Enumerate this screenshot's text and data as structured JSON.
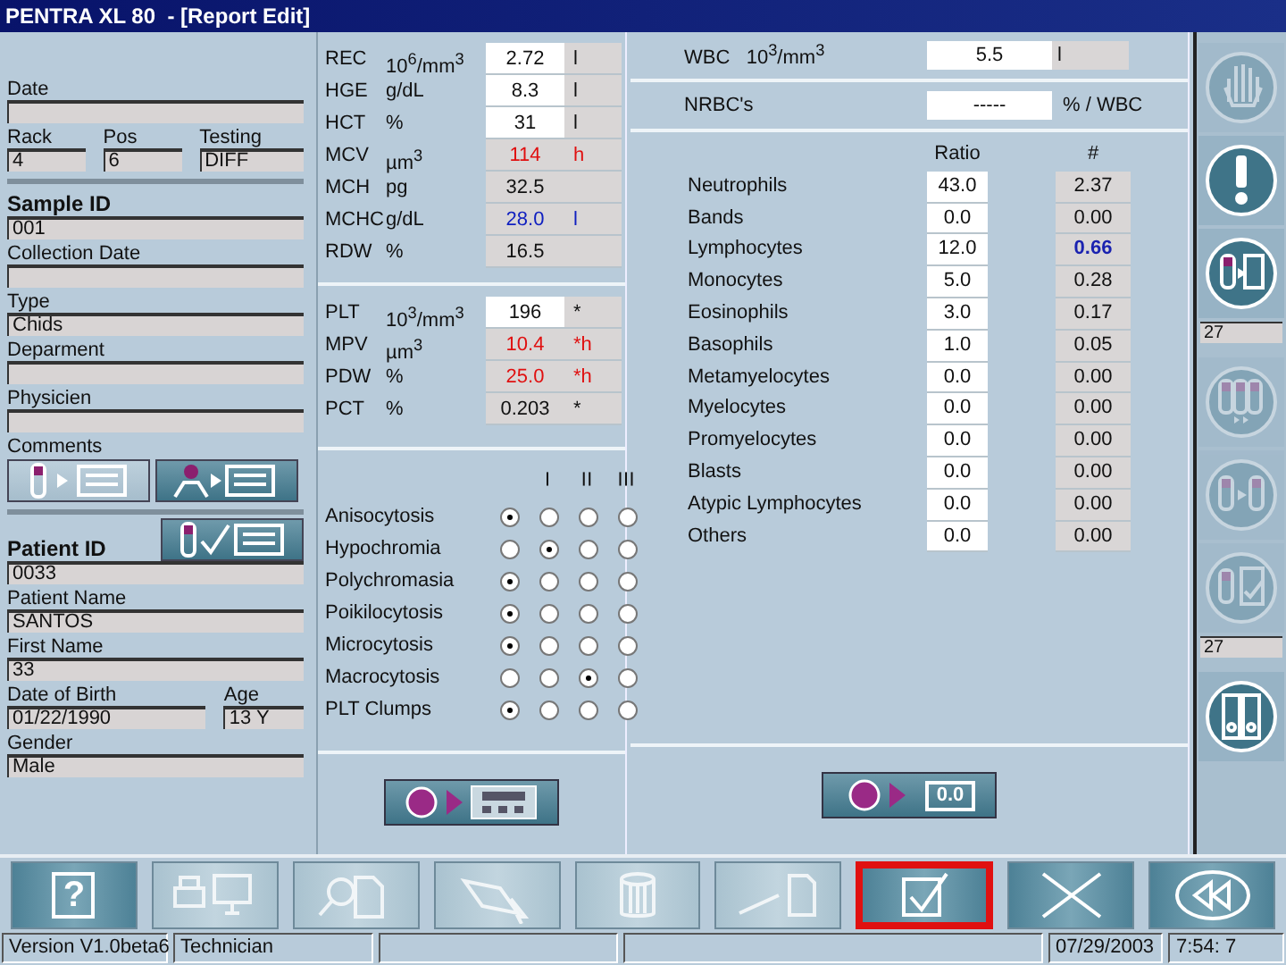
{
  "window": {
    "title": "PENTRA XL 80  - [Report Edit]"
  },
  "sample_info": [
    {
      "kind": "field",
      "label": "Date"
    },
    {
      "kind": "group",
      "fields": [
        {
          "label": "Rack",
          "value": "4"
        },
        {
          "label": "Pos",
          "value": "6"
        },
        {
          "label": "Testing",
          "value": "DIFF"
        }
      ]
    },
    {
      "kind": "heading",
      "label": "Sample ID",
      "value": "001"
    },
    {
      "kind": "field",
      "label": "Collection Date"
    },
    {
      "kind": "field",
      "label": "Type",
      "value": "Chids"
    },
    {
      "kind": "field",
      "label": "Deparment"
    },
    {
      "kind": "field",
      "label": "Physicien"
    },
    {
      "kind": "buttons",
      "label": "Comments",
      "buttons": [
        {
          "disabled": true
        },
        {
          "disabled": false
        }
      ]
    },
    {
      "kind": "heading",
      "label": "Patient ID",
      "value": "0033",
      "button": {
        "disabled": false
      }
    },
    {
      "kind": "field",
      "label": "Patient Name",
      "value": "SANTOS"
    },
    {
      "kind": "field",
      "label": "First Name",
      "value": "33"
    },
    {
      "kind": "group",
      "fields": [
        {
          "label": "Date of Birth",
          "value": "01/22/1990"
        },
        {
          "label": "Age",
          "value": "13 Y"
        }
      ]
    },
    {
      "kind": "field",
      "label": "Gender",
      "value": "Male"
    }
  ],
  "red_cells": [
    {
      "name": "REC",
      "unit": "10$^{6}$/mm$^{3}$",
      "value": "2.72",
      "flag": "l",
      "editable": true
    },
    {
      "name": "HGE",
      "unit": "g/dL",
      "value": "8.3",
      "flag": "l",
      "editable": true
    },
    {
      "name": "HCT",
      "unit": "%",
      "value": "31",
      "flag": "l",
      "editable": true
    },
    {
      "name": "MCV",
      "unit": "µm$^{3}$",
      "value": "114",
      "flag": "h",
      "editable": false,
      "color": "#e01010"
    },
    {
      "name": "MCH",
      "unit": "pg",
      "value": "32.5",
      "editable": false
    },
    {
      "name": "MCHC",
      "unit": "g/dL",
      "value": "28.0",
      "flag": "l",
      "editable": false,
      "color": "#1020c0"
    },
    {
      "name": "RDW",
      "unit": "%",
      "value": "16.5",
      "editable": false
    }
  ],
  "platelets": [
    {
      "name": "PLT",
      "unit": "10$^{3}$/mm$^{3}$",
      "value": "196",
      "flag": "*",
      "editable": true
    },
    {
      "name": "MPV",
      "unit": "µm$^{3}$",
      "value": "10.4",
      "flag": "*h",
      "editable": false,
      "color": "#e01010"
    },
    {
      "name": "PDW",
      "unit": "%",
      "value": "25.0",
      "flag": "*h",
      "editable": false,
      "color": "#e01010"
    },
    {
      "name": "PCT",
      "unit": "%",
      "value": "0.203",
      "flag": "*",
      "editable": false
    }
  ],
  "morphology": {
    "grade_headers": [
      "|",
      "||",
      "|||"
    ],
    "rows": [
      {
        "name": "Anisocytosis",
        "options": [
          {
            "selected": true
          },
          {
            "selected": false
          },
          {
            "selected": false
          },
          {
            "selected": false
          }
        ]
      },
      {
        "name": "Hypochromia",
        "options": [
          {
            "selected": false
          },
          {
            "selected": true
          },
          {
            "selected": false
          },
          {
            "selected": false
          }
        ]
      },
      {
        "name": "Polychromasia",
        "options": [
          {
            "selected": true
          },
          {
            "selected": false
          },
          {
            "selected": false
          },
          {
            "selected": false
          }
        ]
      },
      {
        "name": "Poikilocytosis",
        "options": [
          {
            "selected": true
          },
          {
            "selected": false
          },
          {
            "selected": false
          },
          {
            "selected": false
          }
        ]
      },
      {
        "name": "Microcytosis",
        "options": [
          {
            "selected": true
          },
          {
            "selected": false
          },
          {
            "selected": false
          },
          {
            "selected": false
          }
        ]
      },
      {
        "name": "Macrocytosis",
        "options": [
          {
            "selected": false
          },
          {
            "selected": false
          },
          {
            "selected": true
          },
          {
            "selected": false
          }
        ]
      },
      {
        "name": "PLT Clumps",
        "options": [
          {
            "selected": true
          },
          {
            "selected": false
          },
          {
            "selected": false
          },
          {
            "selected": false
          }
        ]
      }
    ]
  },
  "wbc": {
    "name": "WBC",
    "unit": "10$^{3}$/mm$^{3}$",
    "value": "5.5",
    "flag": "l"
  },
  "nrbc": {
    "name": "NRBC's",
    "value": "-----",
    "unit": "% / WBC"
  },
  "differential": {
    "columns": [
      "Ratio",
      "#"
    ],
    "rows": [
      {
        "name": "Neutrophils",
        "ratio": "43.0",
        "count": "2.37"
      },
      {
        "name": "Bands",
        "ratio": "0.0",
        "count": "0.00"
      },
      {
        "name": "Lymphocytes",
        "ratio": "12.0",
        "count": "0.66",
        "color": "#1a22b0"
      },
      {
        "name": "Monocytes",
        "ratio": "5.0",
        "count": "0.28"
      },
      {
        "name": "Eosinophils",
        "ratio": "3.0",
        "count": "0.17"
      },
      {
        "name": "Basophils",
        "ratio": "1.0",
        "count": "0.05"
      },
      {
        "name": "Metamyelocytes",
        "ratio": "0.0",
        "count": "0.00"
      },
      {
        "name": "Myelocytes",
        "ratio": "0.0",
        "count": "0.00"
      },
      {
        "name": "Promyelocytes",
        "ratio": "0.0",
        "count": "0.00"
      },
      {
        "name": "Blasts",
        "ratio": "0.0",
        "count": "0.00"
      },
      {
        "name": "Atypic Lymphocytes",
        "ratio": "0.0",
        "count": "0.00"
      },
      {
        "name": "Others",
        "ratio": "0.0",
        "count": "0.00"
      }
    ],
    "button_label": "0.0"
  },
  "sidebar": [
    {
      "disabled": true
    },
    {
      "disabled": false
    },
    {
      "disabled": false,
      "counter": "27"
    },
    {
      "disabled": true
    },
    {
      "disabled": true
    },
    {
      "disabled": true,
      "counter": "27"
    },
    {
      "disabled": false
    }
  ],
  "toolbar": [
    {
      "disabled": false,
      "highlighted": false,
      "glyph": "?"
    },
    {
      "disabled": true,
      "highlighted": false
    },
    {
      "disabled": true,
      "highlighted": false
    },
    {
      "disabled": true,
      "highlighted": false
    },
    {
      "disabled": true,
      "highlighted": false
    },
    {
      "disabled": true,
      "highlighted": false
    },
    {
      "disabled": false,
      "highlighted": true
    },
    {
      "disabled": false,
      "highlighted": false
    },
    {
      "disabled": false,
      "highlighted": false
    }
  ],
  "status_bar": {
    "version": "Version V1.0beta6",
    "user": "Technician",
    "date": "07/29/2003",
    "time": "7:54: 7"
  }
}
